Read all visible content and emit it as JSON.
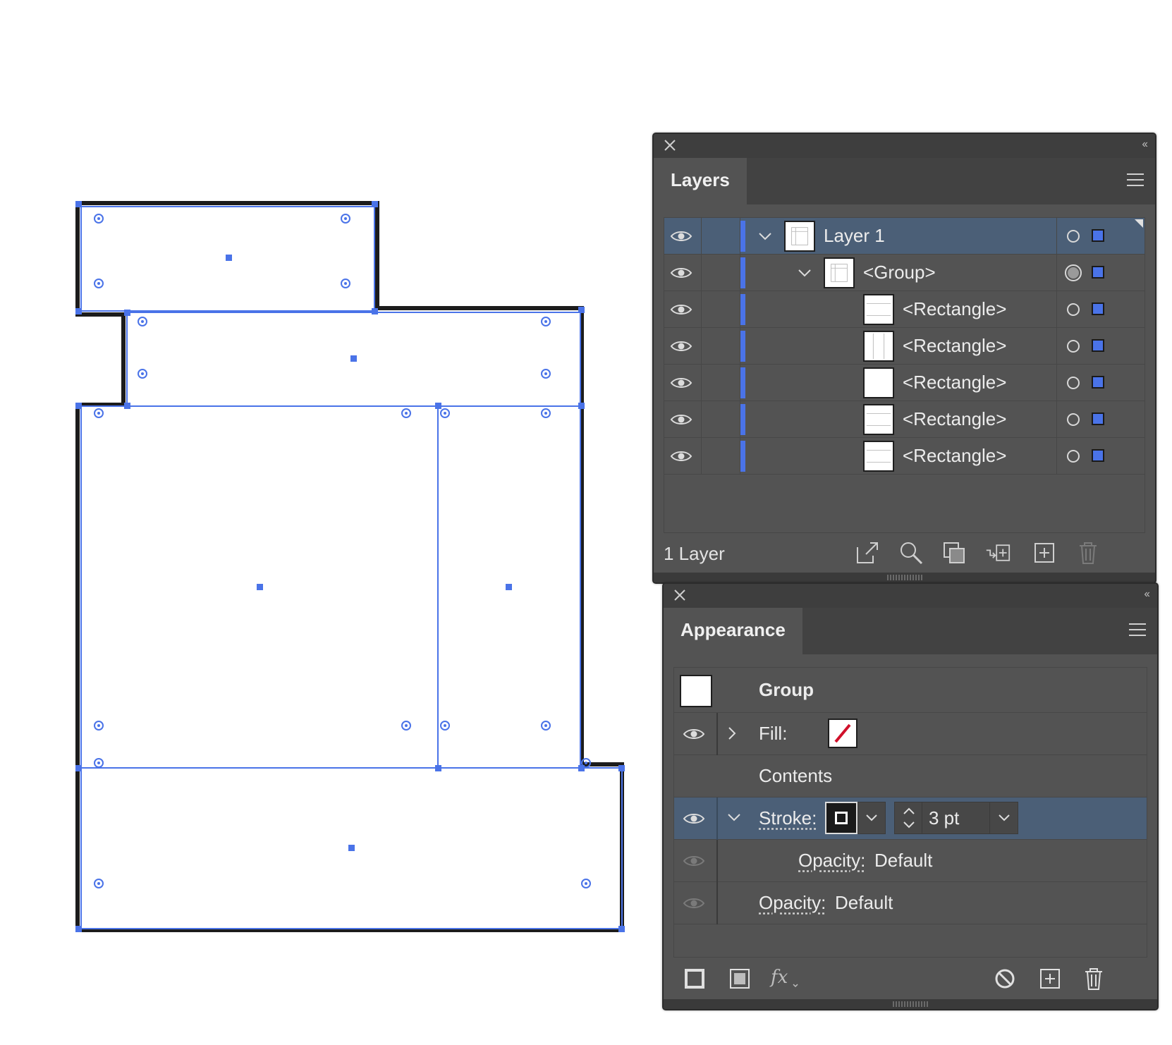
{
  "layers_panel": {
    "title": "Layers",
    "rows": [
      {
        "name": "Layer 1"
      },
      {
        "name": "<Group>"
      },
      {
        "name": "<Rectangle>"
      },
      {
        "name": "<Rectangle>"
      },
      {
        "name": "<Rectangle>"
      },
      {
        "name": "<Rectangle>"
      },
      {
        "name": "<Rectangle>"
      }
    ],
    "footer_count": "1 Layer"
  },
  "appearance_panel": {
    "title": "Appearance",
    "object_type": "Group",
    "fill_label": "Fill:",
    "contents_label": "Contents",
    "stroke_label": "Stroke:",
    "stroke_weight": "3 pt",
    "opacity_label": "Opacity:",
    "opacity_value": "Default"
  },
  "colors": {
    "selection_blue": "#4a73e8",
    "panel_bg": "#535353",
    "selected_row": "#4b5f77"
  }
}
